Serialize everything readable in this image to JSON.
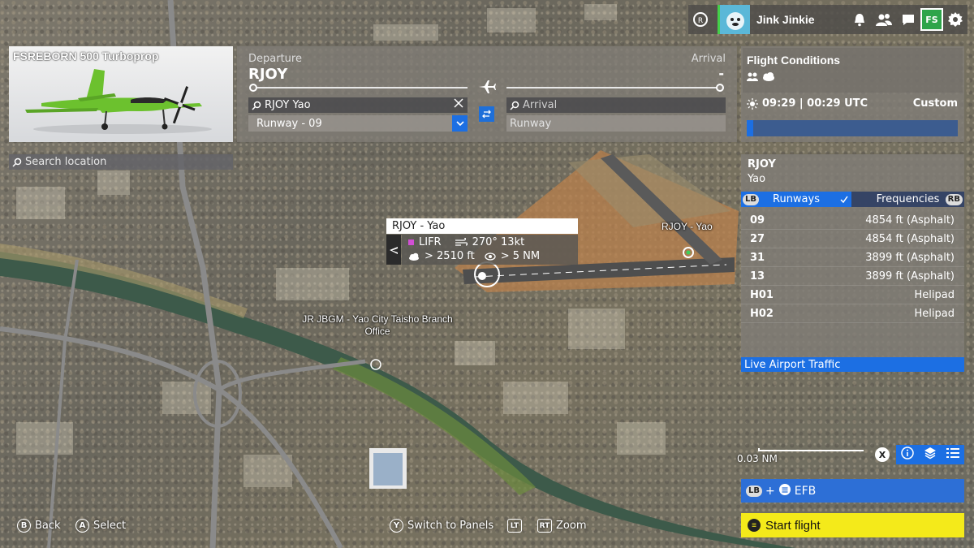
{
  "topbar": {
    "username": "Jink Jinkie",
    "icons": [
      "achievement-icon",
      "avatar",
      "bell-icon",
      "friends-icon",
      "chat-icon",
      "fs-logo-icon",
      "gear-icon"
    ],
    "fs_logo_text": "FS"
  },
  "aircraft": {
    "name": "FSREBORN 500 Turboprop",
    "livery_color": "#6cc12e"
  },
  "search": {
    "placeholder": "Search location"
  },
  "route": {
    "departure_label": "Departure",
    "departure_code": "RJOY",
    "arrival_label": "Arrival",
    "arrival_code": "-",
    "departure_search_value": "RJOY Yao",
    "arrival_search_placeholder": "Arrival",
    "departure_runway": "Runway - 09",
    "arrival_runway": "Runway"
  },
  "conditions": {
    "title": "Flight Conditions",
    "time": "09:29 | 00:29 UTC",
    "mode": "Custom",
    "time_of_day_fraction": 0.03
  },
  "airport": {
    "icao": "RJOY",
    "name": "Yao",
    "tab_runways": "Runways",
    "tab_frequencies": "Frequencies",
    "tab_left_button": "LB",
    "tab_right_button": "RB",
    "runways": [
      {
        "id": "09",
        "info": "4854 ft (Asphalt)"
      },
      {
        "id": "27",
        "info": "4854 ft (Asphalt)"
      },
      {
        "id": "31",
        "info": "3899 ft (Asphalt)"
      },
      {
        "id": "13",
        "info": "3899 ft (Asphalt)"
      },
      {
        "id": "H01",
        "info": "Helipad"
      },
      {
        "id": "H02",
        "info": "Helipad"
      }
    ],
    "live_traffic": "Live Airport Traffic"
  },
  "popup": {
    "title": "RJOY - Yao",
    "category": "LIFR",
    "wind": "270° 13kt",
    "ceiling": "> 2510 ft",
    "visibility": "> 5 NM",
    "category_color": "#d14fd4"
  },
  "map": {
    "airport_label": "RJOY - Yao",
    "poi_label": "JR JBGM - Yao City Taisho Branch Office",
    "scale": "0.03 NM"
  },
  "efb": {
    "prefix": "LB",
    "label": "EFB"
  },
  "start": {
    "label": "Start flight"
  },
  "hints": {
    "back_btn": "B",
    "back": "Back",
    "select_btn": "A",
    "select": "Select",
    "panels_btn": "Y",
    "panels": "Switch to Panels",
    "lt_btn": "LT",
    "rt_btn": "RT",
    "zoom": "Zoom"
  },
  "map_tools": {
    "close_btn": "X"
  },
  "colors": {
    "accent": "#1c6fe3",
    "start": "#f4ea1a",
    "fs_green": "#2ea44a"
  }
}
